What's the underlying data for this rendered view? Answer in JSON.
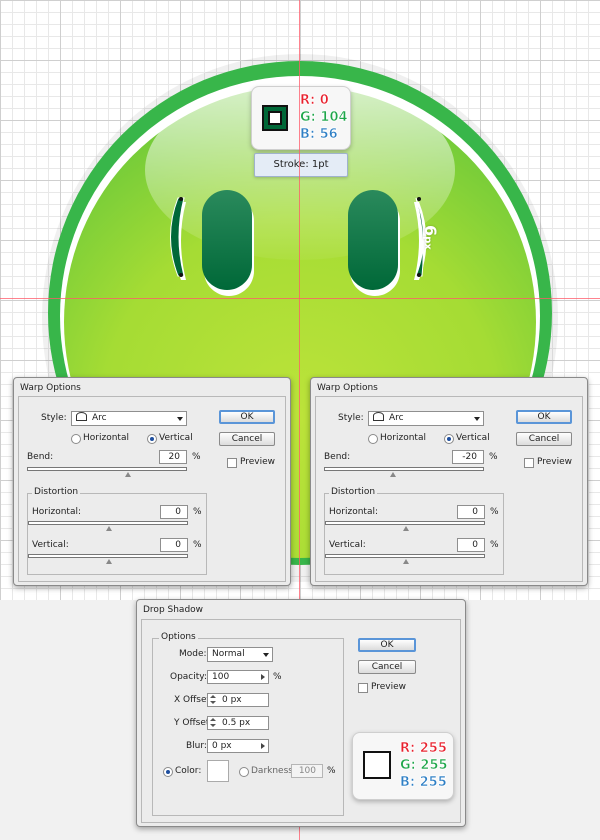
{
  "colors": {
    "face_light": "#bce33a",
    "face_mid": "#8fd631",
    "face_rim": "#38b64a",
    "eye_dark": "#006838",
    "guide": "#ff5a6a",
    "accent_blue": "#5a95d8"
  },
  "top_color_popup": {
    "swatch_icon": "stroke-swatch-icon",
    "r_label": "R: 0",
    "g_label": "G: 104",
    "b_label": "B: 56",
    "stroke_label": "Stroke: 1pt"
  },
  "measure_label": {
    "value": "6",
    "unit": "px"
  },
  "warp_left": {
    "title": "Warp Options",
    "style_label": "Style:",
    "style_value": "Arc",
    "horizontal_label": "Horizontal",
    "vertical_label": "Vertical",
    "orientation_selected": "Vertical",
    "bend_label": "Bend:",
    "bend_value": "20",
    "percent": "%",
    "distortion_label": "Distortion",
    "dist_horizontal_label": "Horizontal:",
    "dist_horizontal_value": "0",
    "dist_vertical_label": "Vertical:",
    "dist_vertical_value": "0",
    "ok_label": "OK",
    "cancel_label": "Cancel",
    "preview_label": "Preview"
  },
  "warp_right": {
    "title": "Warp Options",
    "style_label": "Style:",
    "style_value": "Arc",
    "horizontal_label": "Horizontal",
    "vertical_label": "Vertical",
    "orientation_selected": "Vertical",
    "bend_label": "Bend:",
    "bend_value": "-20",
    "percent": "%",
    "distortion_label": "Distortion",
    "dist_horizontal_label": "Horizontal:",
    "dist_horizontal_value": "0",
    "dist_vertical_label": "Vertical:",
    "dist_vertical_value": "0",
    "ok_label": "OK",
    "cancel_label": "Cancel",
    "preview_label": "Preview"
  },
  "drop_shadow": {
    "title": "Drop Shadow",
    "options_label": "Options",
    "mode_label": "Mode:",
    "mode_value": "Normal",
    "opacity_label": "Opacity:",
    "opacity_value": "100",
    "percent": "%",
    "x_offset_label": "X Offset:",
    "x_offset_value": "0 px",
    "y_offset_label": "Y Offset:",
    "y_offset_value": "0.5 px",
    "blur_label": "Blur:",
    "blur_value": "0 px",
    "color_label": "Color:",
    "darkness_label": "Darkness:",
    "darkness_value": "100",
    "color_selected": "Color",
    "ok_label": "OK",
    "cancel_label": "Cancel",
    "preview_label": "Preview",
    "r_label": "R: 255",
    "g_label": "G: 255",
    "b_label": "B: 255"
  }
}
